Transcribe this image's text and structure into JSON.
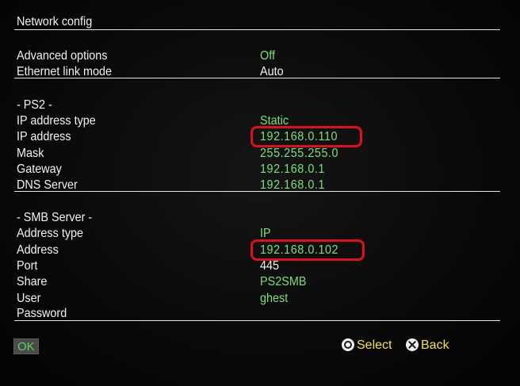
{
  "page_title": "Network config",
  "general": {
    "advanced_options": {
      "label": "Advanced options",
      "value": "Off"
    },
    "ethernet_link_mode": {
      "label": "Ethernet link mode",
      "value": "Auto"
    }
  },
  "ps2": {
    "heading": "- PS2 -",
    "ip_address_type": {
      "label": "IP address type",
      "value": "Static"
    },
    "ip_address": {
      "label": "IP address",
      "value": "192.168.0.110"
    },
    "mask": {
      "label": "Mask",
      "value": "255.255.255.0"
    },
    "gateway": {
      "label": "Gateway",
      "value": "192.168.0.1"
    },
    "dns_server": {
      "label": "DNS Server",
      "value": "192.168.0.1"
    }
  },
  "smb": {
    "heading": "- SMB Server -",
    "address_type": {
      "label": "Address type",
      "value": "IP"
    },
    "address": {
      "label": "Address",
      "value": "192.168.0.102"
    },
    "port": {
      "label": "Port",
      "value": "445"
    },
    "share": {
      "label": "Share",
      "value": "PS2SMB"
    },
    "user": {
      "label": "User",
      "value": "ghest"
    },
    "password": {
      "label": "Password",
      "value": ""
    }
  },
  "footer": {
    "ok_label": "OK",
    "select_label": "Select",
    "back_label": "Back",
    "select_icon": "circle-button-icon",
    "back_icon": "cross-button-icon"
  },
  "colors": {
    "label_text": "#f2f2f2",
    "value_text": "#7be07b",
    "highlight_outline": "#e0101a",
    "hint_text": "#f3e14a"
  }
}
